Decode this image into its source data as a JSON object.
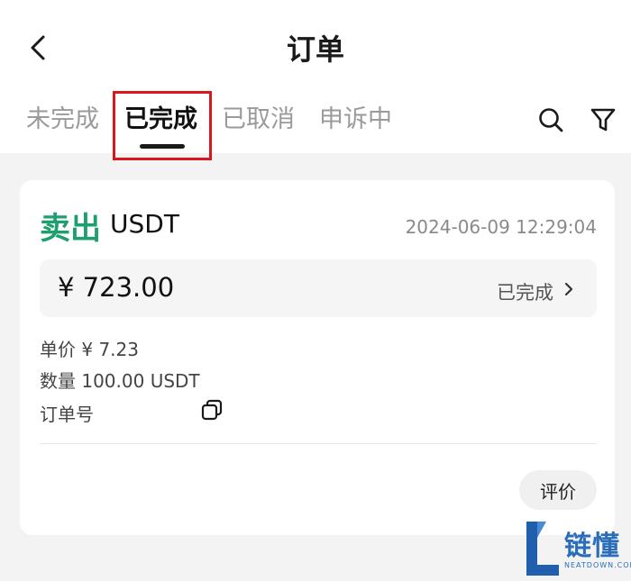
{
  "header": {
    "title": "订单",
    "back_icon": "chevron-left-icon"
  },
  "tabs": [
    {
      "label": "未完成",
      "active": false
    },
    {
      "label": "已完成",
      "active": true
    },
    {
      "label": "已取消",
      "active": false
    },
    {
      "label": "申诉中",
      "active": false
    }
  ],
  "toolbar": {
    "search_icon": "search-icon",
    "filter_icon": "filter-icon"
  },
  "order": {
    "side": "卖出",
    "coin": "USDT",
    "time": "2024-06-09 12:29:04",
    "amount": "¥ 723.00",
    "status": "已完成",
    "price": "单价 ¥ 7.23",
    "quantity": "数量 100.00 USDT",
    "order_no_label": "订单号",
    "rate_label": "评价"
  },
  "watermark": {
    "name": "链懂",
    "site": "NEATDOWN.COM"
  },
  "colors": {
    "sell_green": "#1d9f6e",
    "highlight_red": "#d9161b",
    "background": "#f3f3f3",
    "watermark_blue": "#2a6db8"
  }
}
